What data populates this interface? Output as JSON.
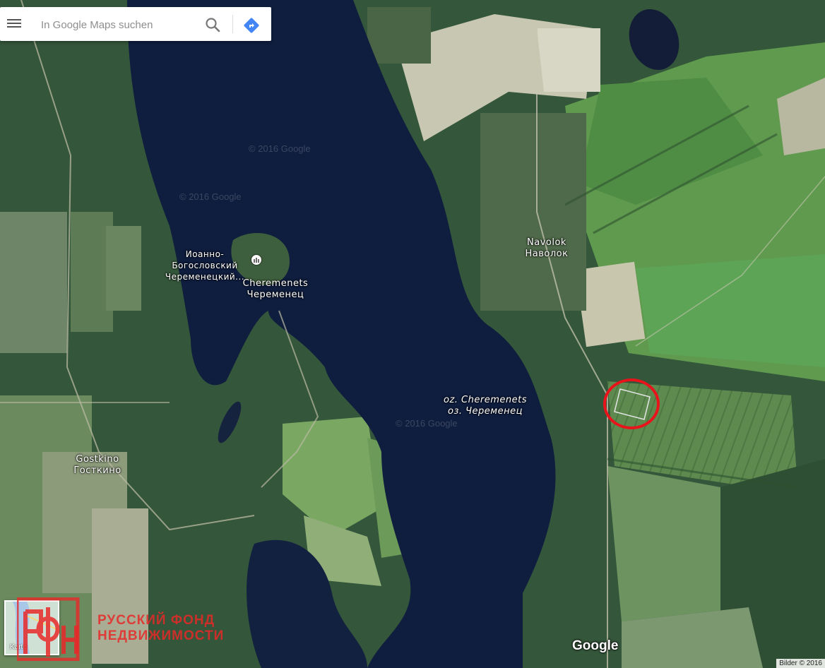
{
  "search": {
    "placeholder": "In Google Maps suchen"
  },
  "labels": {
    "monastery_line1": "Иоанно-Богословский",
    "monastery_line2": "Череменецкий...",
    "cheremenets_en": "Cheremenets",
    "cheremenets_ru": "Череменец",
    "navolok_en": "Navolok",
    "navolok_ru": "Наволок",
    "lake_en": "oz. Cheremenets",
    "lake_ru": "оз. Череменец",
    "gostkino_en": "Gostkino",
    "gostkino_ru": "Госткино"
  },
  "map_watermark": "© 2016 Google",
  "branding": {
    "google": "Google",
    "footer": "Bilder © 2016"
  },
  "mini_map": {
    "label": "Karte"
  },
  "watermark": {
    "line1": "РУССКИЙ  ФОНД",
    "line2": "НЕДВИЖИМОСТИ"
  },
  "colors": {
    "marker": "#e8141c",
    "water": "#0f1d3e",
    "forest": "#2e5230",
    "field": "#6f9a5a"
  }
}
